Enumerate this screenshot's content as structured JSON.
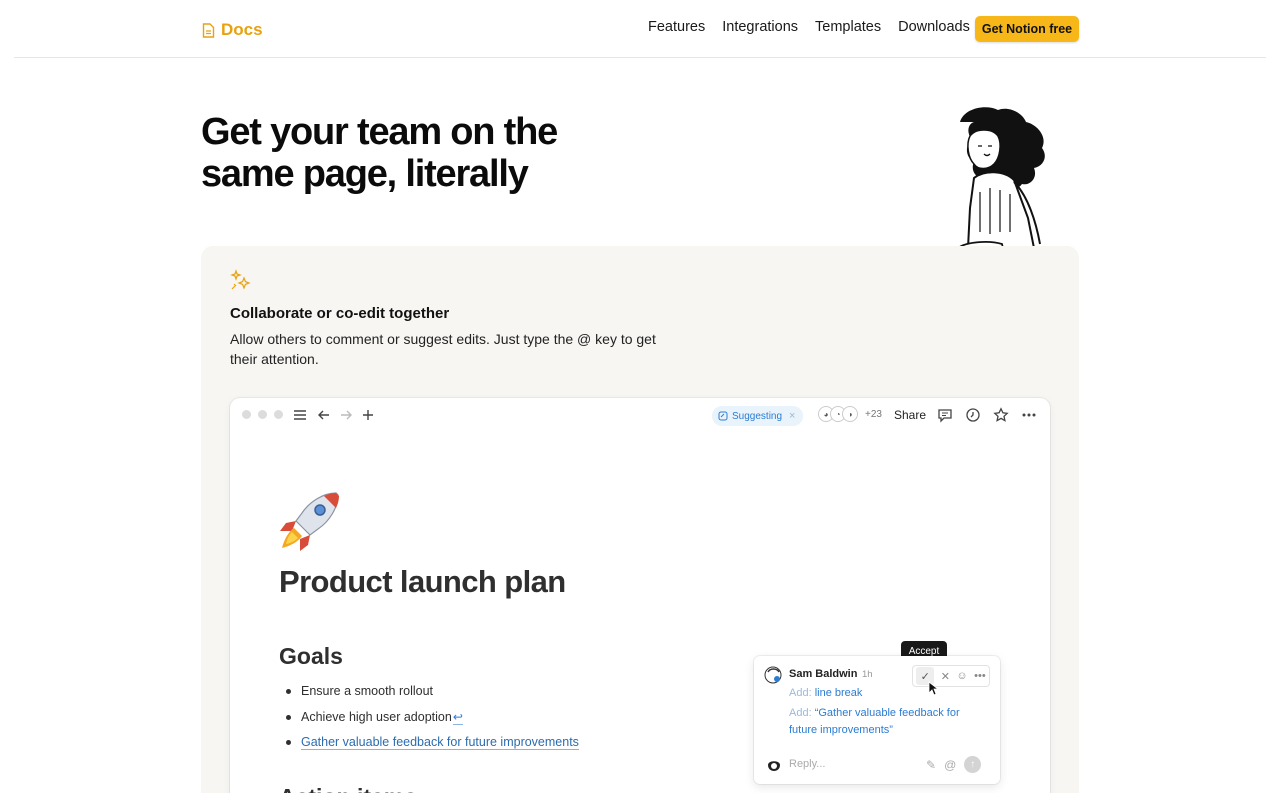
{
  "nav": {
    "brand": "Docs",
    "links": [
      "Features",
      "Integrations",
      "Templates",
      "Downloads"
    ],
    "cta": "Get Notion free"
  },
  "hero": {
    "title": "Get your team on the same page, literally"
  },
  "feature": {
    "title": "Collaborate or co-edit together",
    "description": "Allow others to comment or suggest edits. Just type the @ key to get their attention."
  },
  "app": {
    "suggesting_label": "Suggesting",
    "collaborator_count": "+23",
    "share_label": "Share",
    "doc_title": "Product launch plan",
    "goals_heading": "Goals",
    "goals": [
      "Ensure a smooth rollout",
      "Achieve high user adoption",
      "Gather valuable feedback for future improvements"
    ],
    "next_heading": "Action items"
  },
  "comment": {
    "tooltip": "Accept",
    "author": "Sam Baldwin",
    "time": "1h",
    "add_label": "Add:",
    "suggestion_1": "line break",
    "suggestion_2": "“Gather valuable feedback for future improvements”",
    "reply_placeholder": "Reply..."
  },
  "colors": {
    "brand": "#e8a210",
    "cta_bg": "#f7b719",
    "suggest_blue": "#2b7cd3",
    "card_bg": "#f7f6f3"
  },
  "icons": {
    "brand": "document-icon",
    "sparkle": "sparkle-icon",
    "menu": "menu-icon",
    "back": "arrow-left-icon",
    "forward": "arrow-right-icon",
    "add": "plus-icon",
    "comments": "comment-icon",
    "history": "clock-icon",
    "favorite": "star-icon",
    "more": "more-icon"
  }
}
